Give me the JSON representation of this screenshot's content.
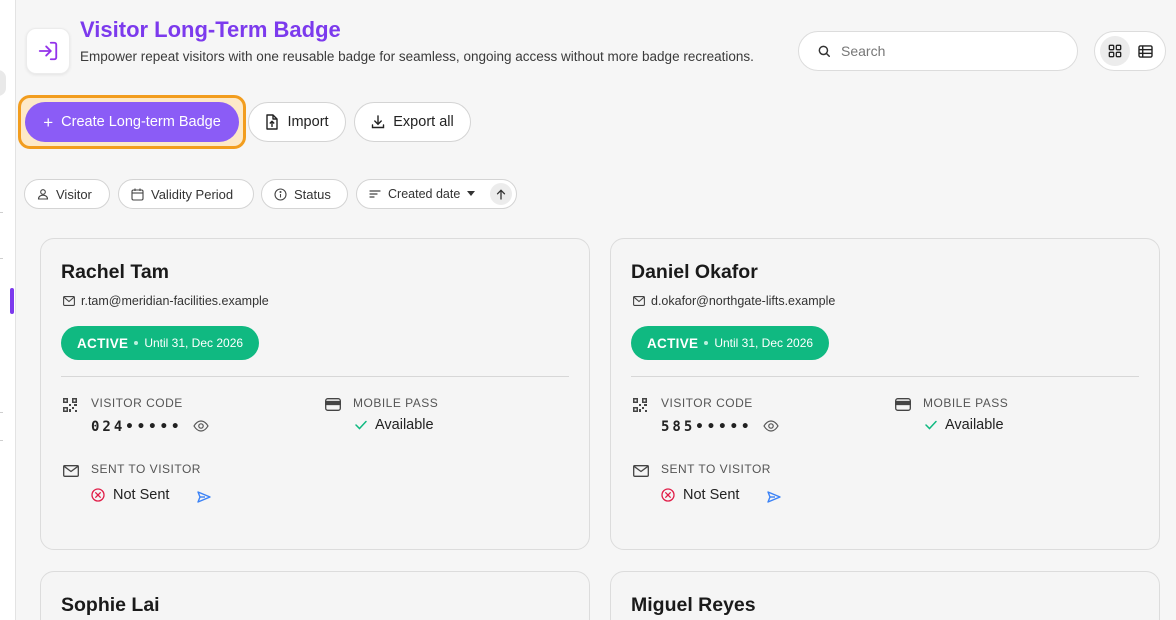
{
  "header": {
    "title": "Visitor Long-Term Badge",
    "subtitle": "Empower repeat visitors with one reusable badge for seamless, ongoing access without more badge recreations.",
    "icon": "sign-in-icon"
  },
  "search": {
    "placeholder": "Search",
    "value": ""
  },
  "view_toggle": {
    "active": "grid",
    "options": [
      "grid",
      "list"
    ]
  },
  "actions": {
    "create_label": "Create Long-term Badge",
    "import_label": "Import",
    "export_label": "Export all"
  },
  "filters": {
    "visitor": "Visitor",
    "validity": "Validity Period",
    "status": "Status",
    "sort": "Created date",
    "sort_direction": "ascending"
  },
  "labels": {
    "visitor_code": "VISITOR CODE",
    "mobile_pass": "MOBILE PASS",
    "sent_to_visitor": "SENT TO VISITOR"
  },
  "colors": {
    "accent": "#7c3aed",
    "button": "#8b5cf6",
    "active": "#10b981",
    "not_sent": "#e11d48",
    "highlight": "#f29d1e"
  },
  "badges": [
    {
      "name": "Rachel Tam",
      "email": "r.tam@meridian-facilities.example",
      "status": "ACTIVE",
      "until": "Until 31, Dec 2026",
      "code": "024•••••",
      "mobile_pass": "Available",
      "sent": "Not Sent"
    },
    {
      "name": "Daniel Okafor",
      "email": "d.okafor@northgate-lifts.example",
      "status": "ACTIVE",
      "until": "Until 31, Dec 2026",
      "code": "585•••••",
      "mobile_pass": "Available",
      "sent": "Not Sent"
    },
    {
      "name": "Sophie Lai"
    },
    {
      "name": "Miguel Reyes"
    }
  ]
}
